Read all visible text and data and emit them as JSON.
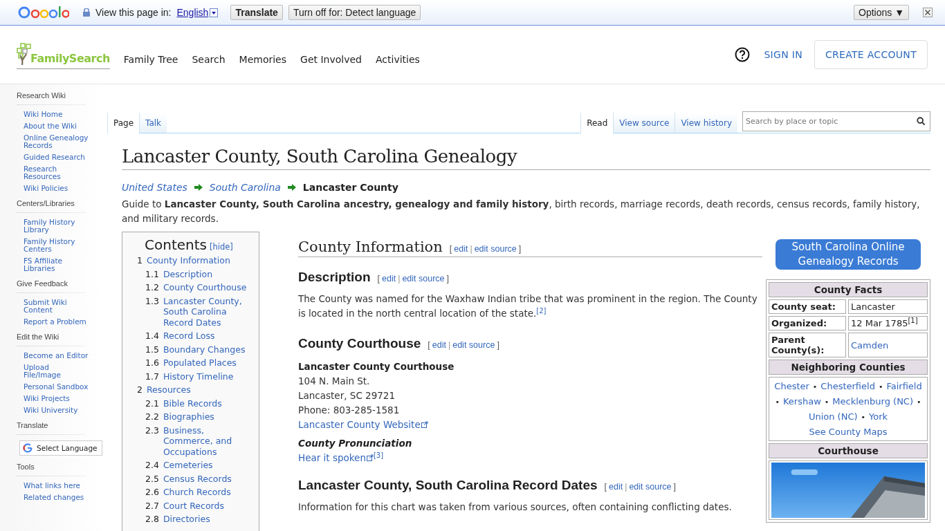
{
  "translate_bar": {
    "label": "View this page in:",
    "language": "English",
    "buttons": [
      "Translate",
      "Turn off for: Detect language"
    ],
    "options": "Options ▼"
  },
  "header": {
    "logo": "FamilySearch",
    "nav": [
      "Family Tree",
      "Search",
      "Memories",
      "Get Involved",
      "Activities"
    ],
    "sign_in": "SIGN IN",
    "create_account": "CREATE ACCOUNT"
  },
  "sidebar": {
    "sections": [
      {
        "title": "Research Wiki",
        "items": [
          "Wiki Home",
          "About the Wiki",
          "Online Genealogy Records",
          "Guided Research",
          "Research Resources",
          "Wiki Policies"
        ]
      },
      {
        "title": "Centers/Libraries",
        "items": [
          "Family History Library",
          "Family History Centers",
          "FS Affiliate Libraries"
        ]
      },
      {
        "title": "Give Feedback",
        "items": [
          "Submit Wiki Content",
          "Report a Problem"
        ]
      },
      {
        "title": "Edit the Wiki",
        "items": [
          "Become an Editor",
          "Upload File/Image",
          "Personal Sandbox",
          "Wiki Projects",
          "Wiki University"
        ]
      },
      {
        "title": "Translate",
        "widget": "Select Language"
      },
      {
        "title": "Tools",
        "items": [
          "What links here",
          "Related changes"
        ]
      }
    ]
  },
  "page_tabs": [
    {
      "label": "Page",
      "selected": true
    },
    {
      "label": "Talk",
      "selected": false
    }
  ],
  "view_tabs": [
    {
      "label": "Read",
      "selected": true
    },
    {
      "label": "View source",
      "selected": false
    },
    {
      "label": "View history",
      "selected": false
    }
  ],
  "search": {
    "placeholder": "Search by place or topic"
  },
  "title": "Lancaster County, South Carolina Genealogy",
  "breadcrumb": [
    {
      "label": "United States",
      "current": false
    },
    {
      "label": "South Carolina",
      "current": false
    },
    {
      "label": "Lancaster County",
      "current": true
    }
  ],
  "intro": "Guide to **Lancaster County, South Carolina ancestry, genealogy and family history**, birth records, marriage records, death records, census records, family history, and military records.",
  "toc": {
    "title": "Contents",
    "hide": "[hide]",
    "items": [
      {
        "number": "1",
        "label": "County Information",
        "children": [
          {
            "number": "1.1",
            "label": "Description"
          },
          {
            "number": "1.2",
            "label": "County Courthouse"
          },
          {
            "number": "1.3",
            "label": "Lancaster County, South Carolina Record Dates"
          },
          {
            "number": "1.4",
            "label": "Record Loss"
          },
          {
            "number": "1.5",
            "label": "Boundary Changes"
          },
          {
            "number": "1.6",
            "label": "Populated Places"
          },
          {
            "number": "1.7",
            "label": "History Timeline"
          }
        ]
      },
      {
        "number": "2",
        "label": "Resources",
        "children": [
          {
            "number": "2.1",
            "label": "Bible Records"
          },
          {
            "number": "2.2",
            "label": "Biographies"
          },
          {
            "number": "2.3",
            "label": "Business, Commerce, and Occupations"
          },
          {
            "number": "2.4",
            "label": "Cemeteries"
          },
          {
            "number": "2.5",
            "label": "Census Records"
          },
          {
            "number": "2.6",
            "label": "Church Records"
          },
          {
            "number": "2.7",
            "label": "Court Records"
          },
          {
            "number": "2.8",
            "label": "Directories"
          }
        ]
      }
    ]
  },
  "sections": [
    {
      "kind": "h2",
      "heading": "County Information",
      "edit": {
        "open": "[",
        "edit": "edit",
        "separator": "|",
        "source": "edit source",
        "close": "]"
      }
    },
    {
      "kind": "h3",
      "heading": "Description",
      "edit": {
        "open": "[",
        "edit": "edit",
        "separator": "|",
        "source": "edit source",
        "close": "]"
      },
      "paragraph": "The County was named for the Waxhaw Indian tribe that was prominent in the region. The County is located in the north central location of the state.",
      "cite": "[2]"
    },
    {
      "kind": "h3",
      "heading": "County Courthouse",
      "edit": {
        "open": "[",
        "edit": "edit",
        "separator": "|",
        "source": "edit source",
        "close": "]"
      },
      "name": "Lancaster County Courthouse",
      "lines": [
        "104 N. Main St.",
        "Lancaster, SC 29721",
        "Phone: 803-285-1581"
      ],
      "website": "Lancaster County Website",
      "pronunciation": "County Pronunciation",
      "hear": "Hear it spoken",
      "hear_cite": "[3]"
    },
    {
      "kind": "h3",
      "heading": "Lancaster County, South Carolina Record Dates",
      "edit": {
        "open": "[",
        "edit": "edit",
        "separator": "|",
        "source": "edit source",
        "close": "]"
      },
      "paragraph": "Information for this chart was taken from various sources, often containing conflicting dates."
    }
  ],
  "online_records_button": "South Carolina Online Genealogy Records",
  "infobox": {
    "title": "County Facts",
    "facts": [
      {
        "label": "County seat:",
        "value": "Lancaster",
        "link": false
      },
      {
        "label": "Organized:",
        "value": "12 Mar 1785",
        "cite": "[1]",
        "link": false
      },
      {
        "label": "Parent County(s):",
        "value": "Camden",
        "link": true
      }
    ],
    "neighbors_title": "Neighboring Counties",
    "neighbors": [
      "Chester",
      "Chesterfield",
      "Fairfield",
      "Kershaw",
      "Mecklenburg (NC)",
      "Union (NC)",
      "York"
    ],
    "separator": "•",
    "maps_link": "See County Maps",
    "courthouse_title": "Courthouse",
    "courthouse_photo": {
      "kind": "picture"
    }
  }
}
